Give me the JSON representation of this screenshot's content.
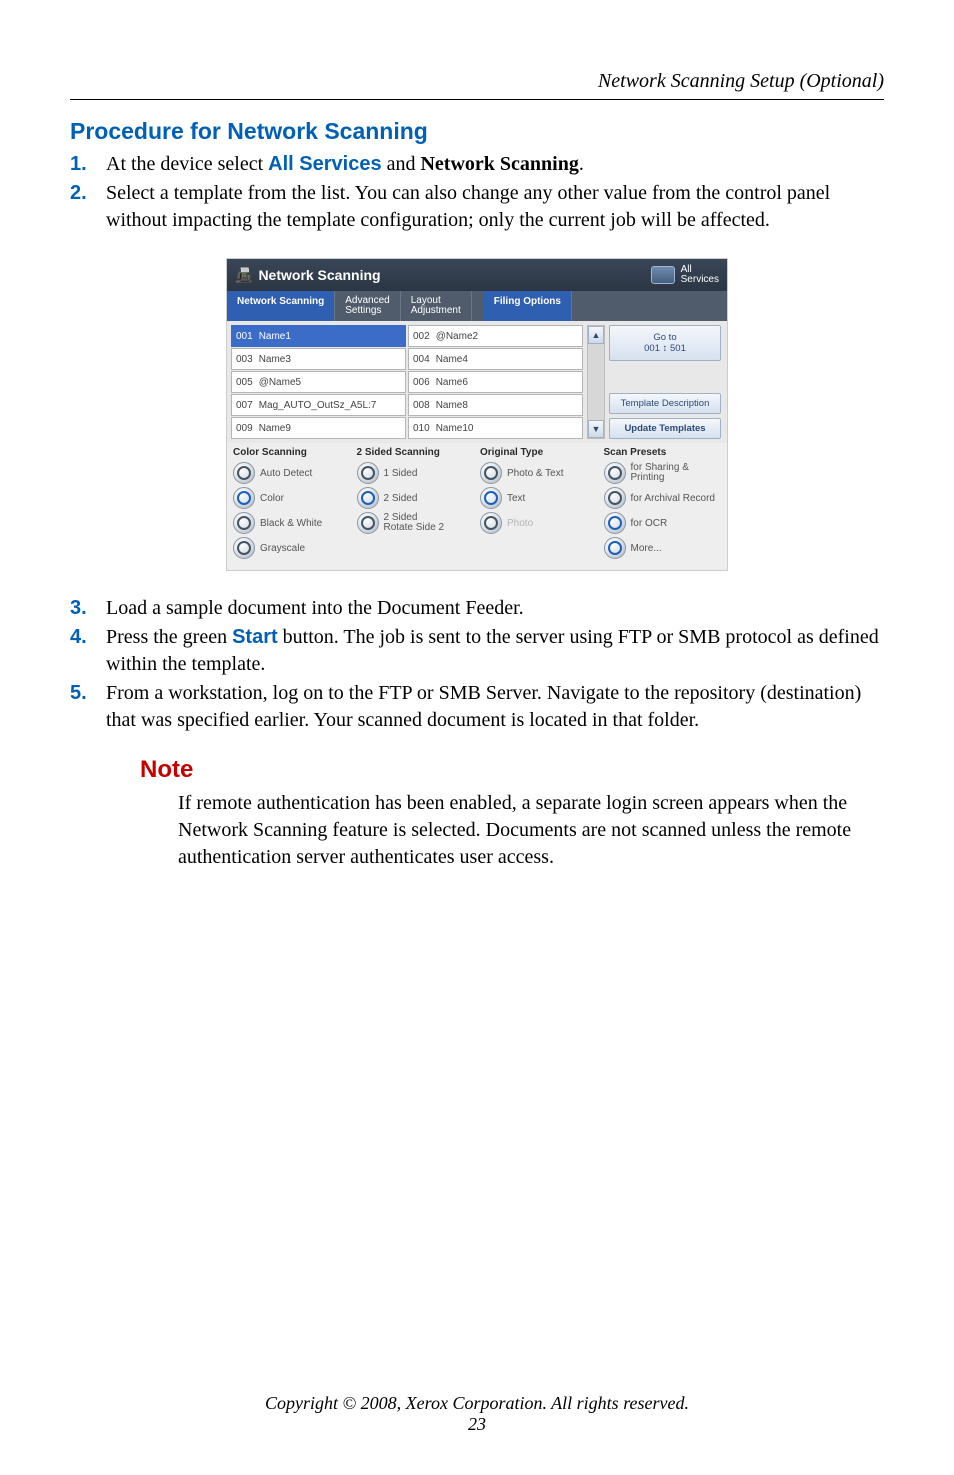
{
  "header": {
    "title": "Network Scanning Setup (Optional)"
  },
  "section_heading": "Procedure for Network Scanning",
  "steps": {
    "s1": {
      "num": "1.",
      "pre": "At the device select ",
      "emph": "All Services",
      "mid": " and ",
      "bold": "Network Scanning",
      "post": "."
    },
    "s2": {
      "num": "2.",
      "text": "Select a template from the list. You can also change any other value from the control panel without impacting the template configuration; only the current job will be affected."
    },
    "s3": {
      "num": "3.",
      "text": "Load a sample document into the Document Feeder."
    },
    "s4": {
      "num": "4.",
      "pre": "Press the green ",
      "emph": "Start",
      "post": " button. The job is sent to the server using FTP or SMB protocol as defined within the template."
    },
    "s5": {
      "num": "5.",
      "text": "From a workstation, log on to the FTP or SMB Server. Navigate to the repository (destination) that was specified earlier. Your scanned document is located in that folder."
    }
  },
  "note": {
    "heading": "Note",
    "body": "If remote authentication has been enabled, a separate login screen appears when the Network Scanning feature is selected. Documents are not scanned unless the remote authentication server authenticates user access."
  },
  "footer": {
    "copyright": "Copyright © 2008, Xerox Corporation. All rights reserved.",
    "page": "23"
  },
  "screenshot": {
    "title": "Network Scanning",
    "all_services": "All\nServices",
    "tabs": {
      "t1": "Network Scanning",
      "t2": "Advanced\nSettings",
      "t3": "Layout\nAdjustment",
      "t4": "Filing Options"
    },
    "templates_left": [
      {
        "id": "001",
        "name": "Name1"
      },
      {
        "id": "003",
        "name": "Name3"
      },
      {
        "id": "005",
        "name": "@Name5"
      },
      {
        "id": "007",
        "name": "Mag_AUTO_OutSz_A5L:7"
      },
      {
        "id": "009",
        "name": "Name9"
      }
    ],
    "templates_right": [
      {
        "id": "002",
        "name": "@Name2"
      },
      {
        "id": "004",
        "name": "Name4"
      },
      {
        "id": "006",
        "name": "Name6"
      },
      {
        "id": "008",
        "name": "Name8"
      },
      {
        "id": "010",
        "name": "Name10"
      }
    ],
    "buttons": {
      "goto_l1": "Go to",
      "goto_l2": "001  ↕ 501",
      "tdesc": "Template Description",
      "update": "Update Templates"
    },
    "color_scanning": {
      "head": "Color Scanning",
      "o1": "Auto Detect",
      "o2": "Color",
      "o3": "Black & White",
      "o4": "Grayscale"
    },
    "two_sided": {
      "head": "2 Sided Scanning",
      "o1": "1 Sided",
      "o2": "2 Sided",
      "o3": "2 Sided\nRotate Side 2"
    },
    "orig_type": {
      "head": "Original Type",
      "o1": "Photo & Text",
      "o2": "Text",
      "o3": "Photo"
    },
    "presets": {
      "head": "Scan Presets",
      "o1": "for Sharing &\nPrinting",
      "o2": "for Archival Record",
      "o3": "for OCR",
      "o4": "More..."
    }
  }
}
